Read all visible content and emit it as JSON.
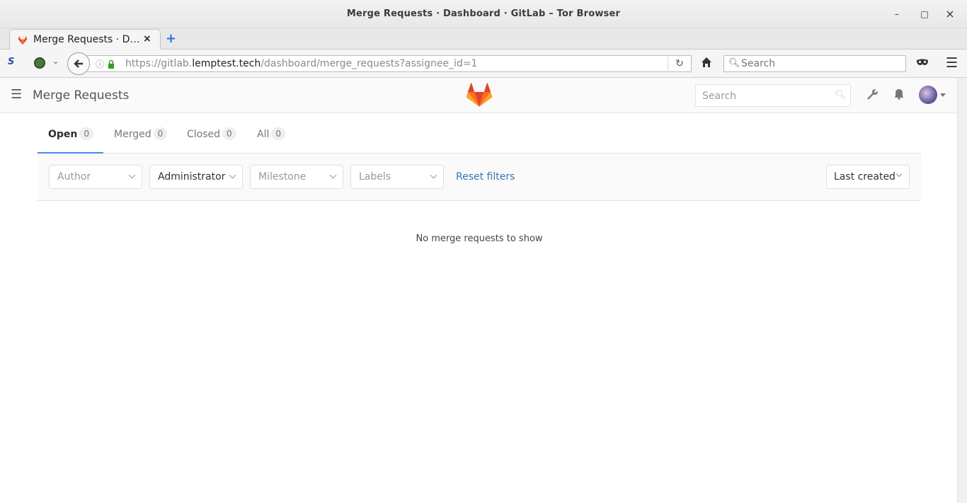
{
  "window": {
    "title": "Merge Requests · Dashboard · GitLab – Tor Browser",
    "minimize": "–",
    "maximize": "□",
    "close": "×"
  },
  "browser": {
    "tab_title": "Merge Requests · D…",
    "tab_close": "×",
    "new_tab": "+",
    "url_prefix": "https://gitlab.",
    "url_host": "lemptest.tech",
    "url_path": "/dashboard/merge_requests?assignee_id=1",
    "search_placeholder": "Search"
  },
  "gitlab": {
    "page_title": "Merge Requests",
    "search_placeholder": "Search"
  },
  "state_tabs": [
    {
      "label": "Open",
      "count": "0"
    },
    {
      "label": "Merged",
      "count": "0"
    },
    {
      "label": "Closed",
      "count": "0"
    },
    {
      "label": "All",
      "count": "0"
    }
  ],
  "filters": {
    "author": "Author",
    "assignee": "Administrator",
    "milestone": "Milestone",
    "labels": "Labels",
    "reset": "Reset filters",
    "sort": "Last created"
  },
  "empty_message": "No merge requests to show",
  "colors": {
    "accent": "#4a8bee",
    "link": "#3777b0",
    "logo_orange": "#e24329"
  }
}
